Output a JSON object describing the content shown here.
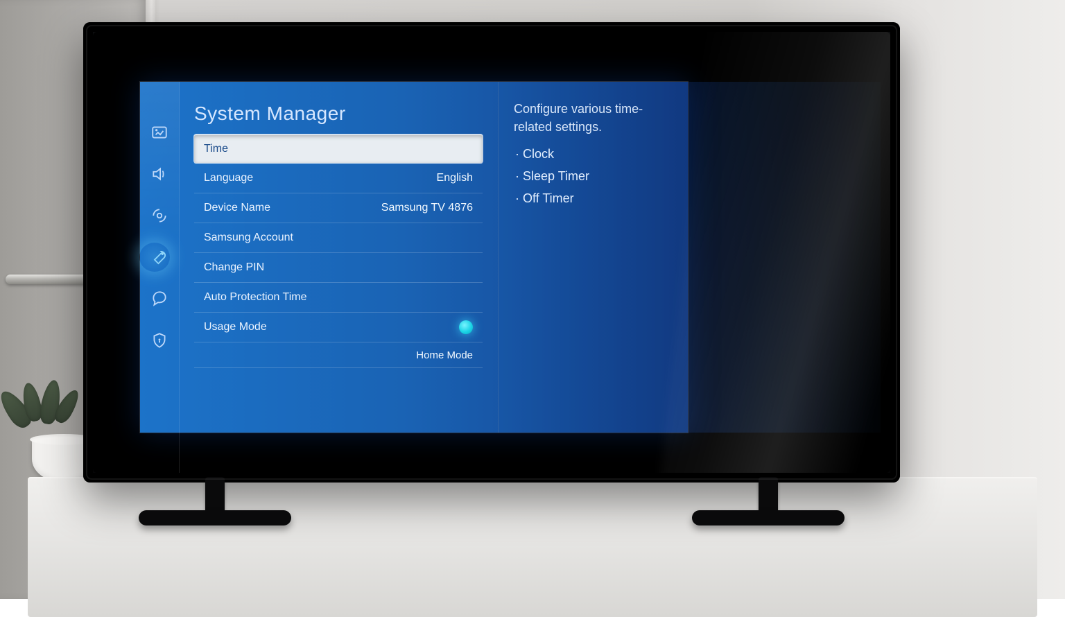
{
  "title": "System Manager",
  "rail": {
    "icons": [
      "picture",
      "sound",
      "broadcast",
      "general",
      "support",
      "privacy"
    ],
    "active": "general"
  },
  "rows": {
    "time": {
      "label": "Time",
      "value": "",
      "selected": true
    },
    "language": {
      "label": "Language",
      "value": "English"
    },
    "device_name": {
      "label": "Device Name",
      "value": "Samsung TV 4876"
    },
    "samsung_account": {
      "label": "Samsung Account",
      "value": ""
    },
    "change_pin": {
      "label": "Change PIN",
      "value": ""
    },
    "auto_protection": {
      "label": "Auto Protection Time",
      "value": ""
    },
    "usage_mode": {
      "label": "Usage Mode",
      "value": "Home Mode",
      "spinner": true
    }
  },
  "description": {
    "text": "Configure various time-related settings.",
    "bullets": [
      "Clock",
      "Sleep Timer",
      "Off Timer"
    ]
  }
}
